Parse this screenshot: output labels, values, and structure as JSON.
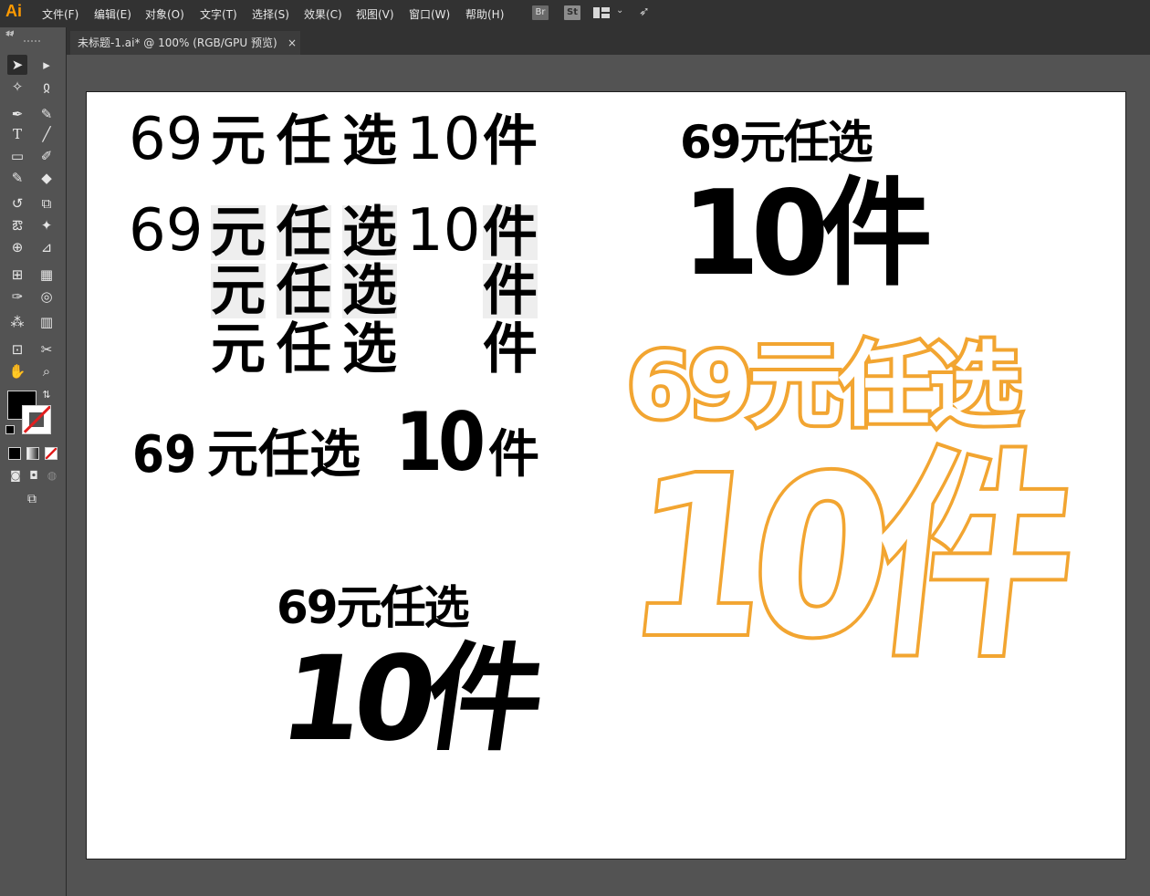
{
  "app": {
    "logo": "Ai"
  },
  "menu": [
    "文件(F)",
    "编辑(E)",
    "对象(O)",
    "文字(T)",
    "选择(S)",
    "效果(C)",
    "视图(V)",
    "窗口(W)",
    "帮助(H)"
  ],
  "menu_buttons": {
    "bridge": "Br",
    "stock": "St"
  },
  "document_tab": {
    "title": "未标题-1.ai* @ 100% (RGB/GPU 预览)",
    "close": "×"
  },
  "colors": {
    "accent_orange": "#f2a531",
    "logo_orange": "#ff9a00",
    "panel_bg": "#535353",
    "menubar_bg": "#323232"
  },
  "artboard": {
    "line1": [
      "69",
      "元",
      "任",
      "选",
      "10",
      "件"
    ],
    "line2": [
      "69",
      "元",
      "任",
      "选",
      "10",
      "件"
    ],
    "line3": [
      "元",
      "任",
      "选",
      "件"
    ],
    "line4": [
      "元",
      "任",
      "选",
      "件"
    ],
    "line5": [
      "69",
      "元任选",
      "10",
      "件"
    ],
    "block_right_top": {
      "top": "69元任选",
      "bottom": "10件"
    },
    "block_bottom_mid": {
      "top": "69元任选",
      "bottom": "10件"
    },
    "block_orange": {
      "top": "69元任选",
      "bottom": "10件"
    }
  }
}
